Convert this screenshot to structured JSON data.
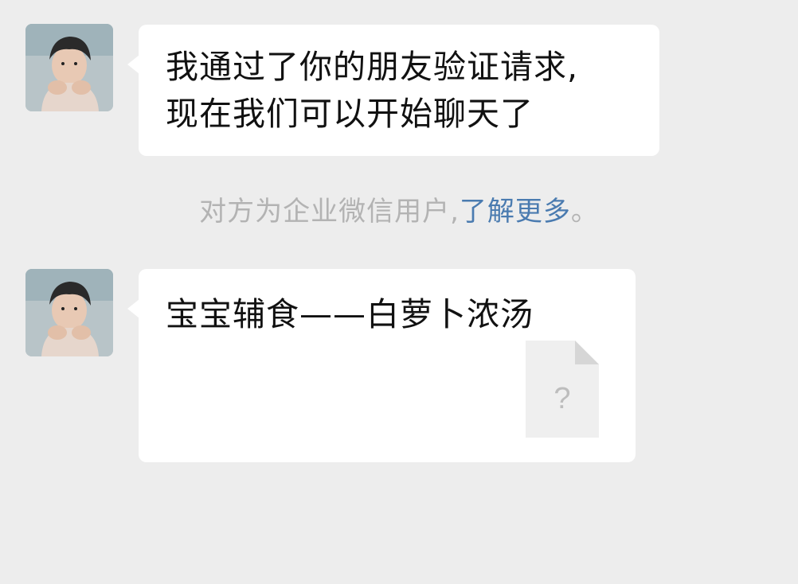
{
  "messages": [
    {
      "lines": [
        "我通过了你的朋友验证请求,",
        "现在我们可以开始聊天了"
      ]
    },
    {
      "title": "宝宝辅食——白萝卜浓汤",
      "file_icon": "file-unknown-icon",
      "file_symbol": "?"
    }
  ],
  "system_notice": {
    "prefix": "对方为企业微信用户,",
    "link": "了解更多",
    "suffix": "。"
  },
  "colors": {
    "background": "#ededed",
    "bubble": "#ffffff",
    "link": "#4a7bb0",
    "notice_text": "#b3b3b3"
  }
}
